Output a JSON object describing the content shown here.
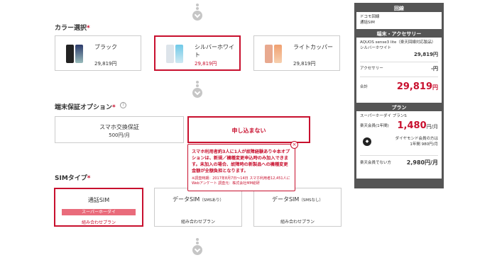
{
  "colors": {
    "accent": "#c8102e",
    "border": "#cccccc",
    "sidebar_bg": "#555555"
  },
  "color_section": {
    "title": "カラー選択",
    "required_mark": "*",
    "options": [
      {
        "name": "ブラック",
        "price": "29,819円",
        "selected": false
      },
      {
        "name": "シルバーホワイト",
        "price": "29,819円",
        "selected": true
      },
      {
        "name": "ライトカッパー",
        "price": "29,819円",
        "selected": false
      }
    ]
  },
  "warranty_section": {
    "title": "端末保証オプション",
    "required_mark": "*",
    "help_label": "?",
    "options": [
      {
        "name": "スマホ交換保証",
        "price": "500円/月",
        "selected": false
      },
      {
        "name": "申し込まない",
        "selected": true
      }
    ],
    "tooltip": {
      "main": "スマホ利用者約3人に1人が故障経験あり※本オプションは、新規／機種変更申込時のみ加入できます。未加入の場合、故障時の新製品への機種変更金額が全額負担となります。",
      "note": "※調査時期：2017年8月7日～14日 スマホ利用者12,451人にWebアンケート 調査元：株式会社MM総研",
      "close": "×"
    }
  },
  "sim_section": {
    "title": "SIMタイプ",
    "required_mark": "*",
    "options": [
      {
        "name": "通話SIM",
        "suffix": "",
        "band": "スーパーホーダイ",
        "sub": "組み合わせプラン",
        "selected": true
      },
      {
        "name": "データSIM",
        "suffix": "（SMSあり）",
        "band": "",
        "sub": "組み合わせプラン",
        "selected": false
      },
      {
        "name": "データSIM",
        "suffix": "（SMSなし）",
        "band": "",
        "sub": "組み合わせプラン",
        "selected": false
      }
    ]
  },
  "sidebar": {
    "line_head": "回線",
    "line_lines": [
      "ドコモ回線",
      "通話SIM"
    ],
    "device_head": "端末・アクセサリー",
    "device_name": "AQUOS sense3 lite（楽天回線対応製品）",
    "device_color": "シルバーホワイト",
    "device_price": "29,819円",
    "accessory_label": "アクセサリー",
    "accessory_price": "-円",
    "total_label": "合計",
    "total_value": "29,819",
    "total_unit": "円",
    "plan_head": "プラン",
    "plan_name": "スーパーホーダイ プランS",
    "member_label": "楽天会員(1年間)",
    "member_price": "1,480",
    "member_unit": "円/月",
    "diamond_text": "ダイヤモンド会員の方は",
    "diamond_price": "1年間 980円/月",
    "nonmember_label": "楽天会員でない方",
    "nonmember_price": "2,980円/月"
  }
}
